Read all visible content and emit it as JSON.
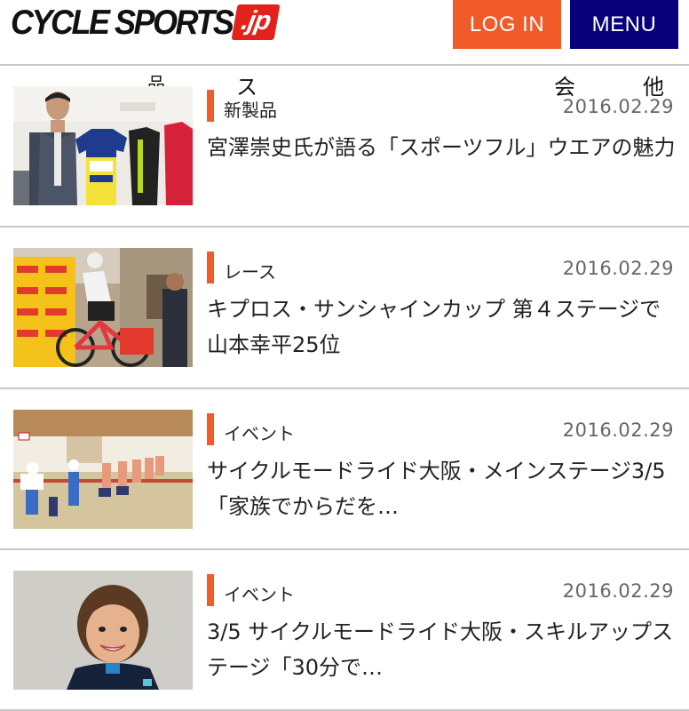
{
  "header": {
    "logo_text": "CYCLE SPORTS",
    "logo_badge": ".jp",
    "login_label": "LOG IN",
    "menu_label": "MENU"
  },
  "nav_ghost": [
    "品",
    "ス",
    "会",
    "他"
  ],
  "articles": [
    {
      "category": "新製品",
      "date": "2016.02.29",
      "title": "宮澤崇史氏が語る「スポーツフル」ウエアの魅力"
    },
    {
      "category": "レース",
      "date": "2016.02.29",
      "title": "キプロス・サンシャインカップ 第４ステージで山本幸平25位"
    },
    {
      "category": "イベント",
      "date": "2016.02.29",
      "title": "サイクルモードライド大阪・メインステージ3/5「家族でからだを…"
    },
    {
      "category": "イベント",
      "date": "2016.02.29",
      "title": "3/5 サイクルモードライド大阪・スキルアップステージ「30分で…"
    }
  ],
  "colors": {
    "accent": "#f15a29",
    "menu": "#08007a",
    "logo_red": "#e2231a"
  }
}
